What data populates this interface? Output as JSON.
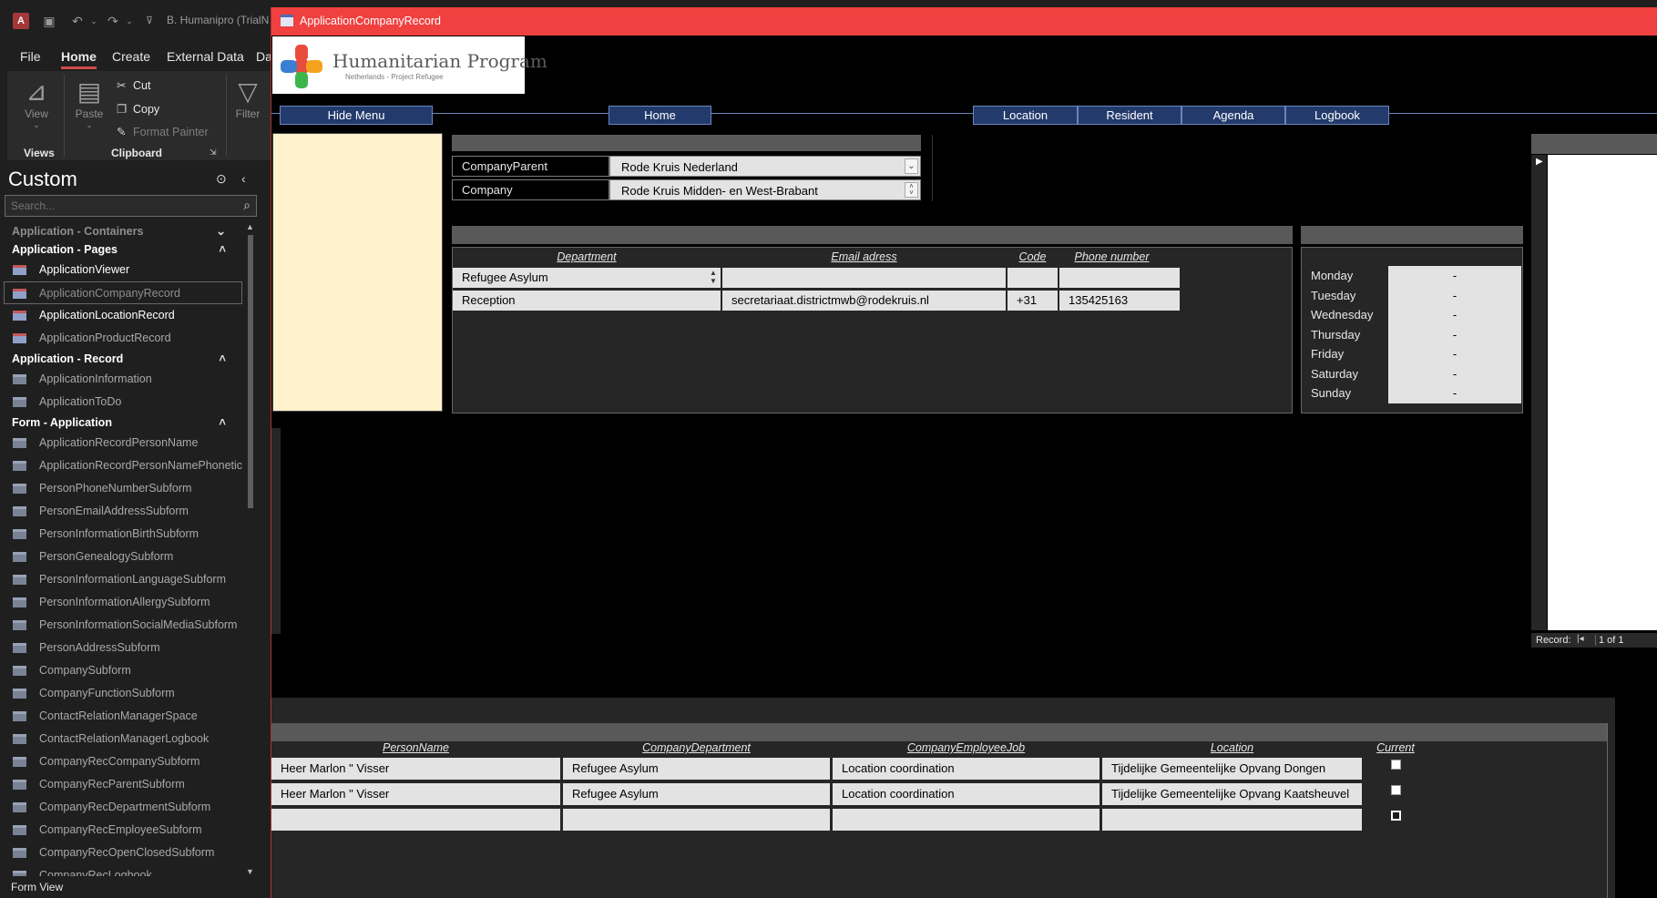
{
  "app": {
    "title": "B. Humanipro (TrialN",
    "ribbon_tabs": [
      "File",
      "Home",
      "Create",
      "External Data",
      "Da"
    ],
    "active_tab": "Home",
    "ribbon": {
      "view_label": "View",
      "paste_label": "Paste",
      "cut_label": "Cut",
      "copy_label": "Copy",
      "format_painter_label": "Format Painter",
      "filter_label": "Filter",
      "views_group": "Views",
      "clipboard_group": "Clipboard"
    },
    "status": "Form View"
  },
  "nav": {
    "header": "Custom",
    "search_placeholder": "Search...",
    "groups": [
      {
        "label": "Application - Containers",
        "dim": true,
        "items": []
      },
      {
        "label": "Application - Pages",
        "items": [
          {
            "label": "ApplicationViewer",
            "state": "bright"
          },
          {
            "label": "ApplicationCompanyRecord",
            "state": "selected"
          },
          {
            "label": "ApplicationLocationRecord",
            "state": "bright"
          },
          {
            "label": "ApplicationProductRecord",
            "state": "normal"
          }
        ]
      },
      {
        "label": "Application - Record",
        "items": [
          {
            "label": "ApplicationInformation",
            "state": "normal"
          },
          {
            "label": "ApplicationToDo",
            "state": "normal"
          }
        ]
      },
      {
        "label": "Form - Application",
        "items": [
          {
            "label": "ApplicationRecordPersonName",
            "state": "normal"
          },
          {
            "label": "ApplicationRecordPersonNamePhonetic",
            "state": "normal"
          },
          {
            "label": "PersonPhoneNumberSubform",
            "state": "normal"
          },
          {
            "label": "PersonEmailAddressSubform",
            "state": "normal"
          },
          {
            "label": "PersonInformationBirthSubform",
            "state": "normal"
          },
          {
            "label": "PersonGenealogySubform",
            "state": "normal"
          },
          {
            "label": "PersonInformationLanguageSubform",
            "state": "normal"
          },
          {
            "label": "PersonInformationAllergySubform",
            "state": "normal"
          },
          {
            "label": "PersonInformationSocialMediaSubform",
            "state": "normal"
          },
          {
            "label": "PersonAddressSubform",
            "state": "normal"
          },
          {
            "label": "CompanySubform",
            "state": "normal"
          },
          {
            "label": "CompanyFunctionSubform",
            "state": "normal"
          },
          {
            "label": "ContactRelationManagerSpace",
            "state": "normal"
          },
          {
            "label": "ContactRelationManagerLogbook",
            "state": "normal"
          },
          {
            "label": "CompanyRecCompanySubform",
            "state": "normal"
          },
          {
            "label": "CompanyRecParentSubform",
            "state": "normal"
          },
          {
            "label": "CompanyRecDepartmentSubform",
            "state": "normal"
          },
          {
            "label": "CompanyRecEmployeeSubform",
            "state": "normal"
          },
          {
            "label": "CompanyRecOpenClosedSubform",
            "state": "normal"
          },
          {
            "label": "CompanyRecLogbook",
            "state": "normal"
          }
        ]
      }
    ]
  },
  "form": {
    "title": "ApplicationCompanyRecord",
    "logo_name": "Humanitarian Program",
    "logo_sub": "Netherlands - Project Refugee",
    "buttons": {
      "hide_menu": "Hide Menu",
      "home": "Home",
      "location": "Location",
      "resident": "Resident",
      "agenda": "Agenda",
      "logbook": "Logbook"
    },
    "company_parent_label": "CompanyParent",
    "company_parent_value": "Rode Kruis Nederland",
    "company_label": "Company",
    "company_value": "Rode Kruis Midden- en West-Brabant",
    "departments": {
      "headers": [
        "Department",
        "Email adress",
        "Code",
        "Phone number"
      ],
      "rows": [
        [
          "Refugee Asylum",
          "",
          "",
          ""
        ],
        [
          "Reception",
          "secretariaat.districtmwb@rodekruis.nl",
          "+31",
          "135425163"
        ]
      ]
    },
    "schedule": [
      {
        "day": "Monday",
        "value": "-"
      },
      {
        "day": "Tuesday",
        "value": "-"
      },
      {
        "day": "Wednesday",
        "value": "-"
      },
      {
        "day": "Thursday",
        "value": "-"
      },
      {
        "day": "Friday",
        "value": "-"
      },
      {
        "day": "Saturday",
        "value": "-"
      },
      {
        "day": "Sunday",
        "value": "-"
      }
    ],
    "record_nav": {
      "label": "Record:",
      "first": "|◂",
      "position": "1 of 1"
    },
    "employees": {
      "headers": [
        "PersonName",
        "CompanyDepartment",
        "CompanyEmployeeJob",
        "Location",
        "Current"
      ],
      "rows": [
        {
          "person": "Heer  Marlon \"  Visser",
          "department": "Refugee Asylum",
          "job": "Location coordination",
          "location": "Tijdelijke Gemeentelijke Opvang Dongen",
          "current": true
        },
        {
          "person": "Heer  Marlon \"  Visser",
          "department": "Refugee Asylum",
          "job": "Location coordination",
          "location": "Tijdelijke Gemeentelijke Opvang Kaatsheuvel",
          "current": true
        },
        {
          "person": "",
          "department": "",
          "job": "",
          "location": "",
          "current": false
        }
      ]
    }
  }
}
